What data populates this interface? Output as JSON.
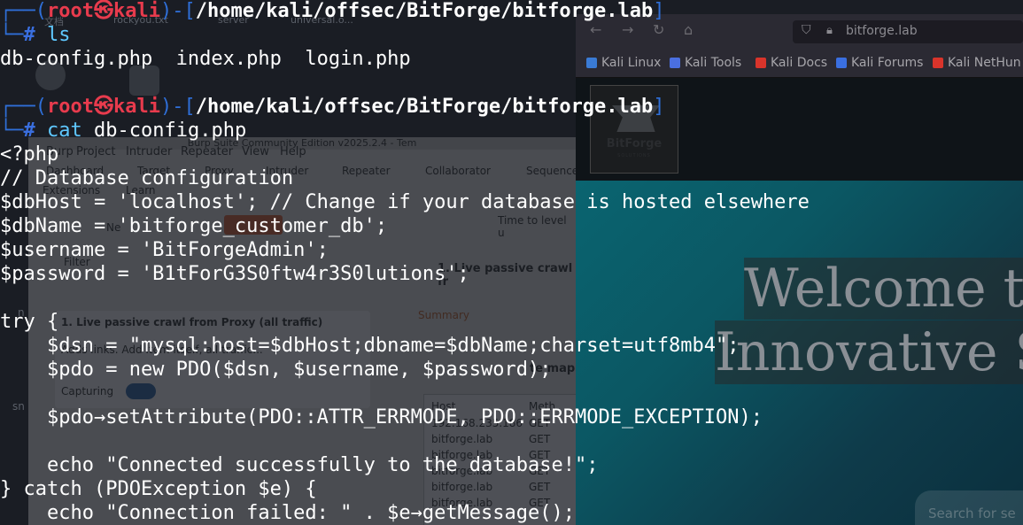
{
  "desktop": {
    "labels": [
      "文档",
      "rockyou.txt",
      "server",
      "universal.o..."
    ],
    "side_label_1": "sn",
    "side_label_2": "n"
  },
  "burp": {
    "window_title": "Burp Suite Community Edition v2025.2.4 - Tem",
    "menu": [
      "Burp",
      "Project",
      "Intruder",
      "Repeater",
      "View",
      "Help"
    ],
    "tabs": [
      "Dashboard",
      "Target",
      "Proxy",
      "Intruder",
      "Repeater",
      "Collaborator",
      "Sequence"
    ],
    "tabs2": [
      "Extensions",
      "Learn"
    ],
    "new_label": "Ne",
    "filter_label": "Filter",
    "time_label": "Time to level u",
    "task_title": "1. Live passive crawl from Proxy (all traffic)",
    "task_title_short": "1. Live passive crawl fr",
    "task_desc": "Adds links. Add item itself, all traffic...",
    "capturing_label": "Capturing",
    "summary_tab": "Summary",
    "site_map_label": "te map",
    "table_headers": [
      "Host",
      "Meth"
    ],
    "table_rows": [
      {
        "host": "192.168.235.186",
        "method": "GET"
      },
      {
        "host": "bitforge.lab",
        "method": "GET"
      },
      {
        "host": "bitforge.lab",
        "method": "GET"
      },
      {
        "host": "bitforge.lab",
        "method": "GET"
      },
      {
        "host": "bitforge.lab",
        "method": "GET"
      },
      {
        "host": "bitforge.lab",
        "method": "GET"
      }
    ]
  },
  "firefox": {
    "url": "bitforge.lab",
    "bookmarks": [
      {
        "label": "Kali Linux",
        "icon": "kali-dragon-icon",
        "color": "#3a7bd5"
      },
      {
        "label": "Kali Tools",
        "icon": "kali-tools-icon",
        "color": "#4a6fe0"
      },
      {
        "label": "Kali Docs",
        "icon": "kali-docs-icon",
        "color": "#d9342b"
      },
      {
        "label": "Kali Forums",
        "icon": "kali-forums-icon",
        "color": "#3a6fe0"
      },
      {
        "label": "Kali NetHun",
        "icon": "kali-nethunter-icon",
        "color": "#d9342b"
      }
    ],
    "site": {
      "logo_name": "BitForge",
      "logo_sub": "SOLUTIONS",
      "hero_line_1": "Welcome t",
      "hero_line_2": "Innovative S",
      "search_placeholder": "Search for se"
    }
  },
  "terminal": {
    "prompt": {
      "user": "root",
      "at": "㉿",
      "host": "kali",
      "cwd": "/home/kali/offsec/BitForge/bitforge.lab",
      "hash": "#"
    },
    "command_1": "ls",
    "ls_output": "db-config.php  index.php  login.php",
    "command_2_name": "cat",
    "command_2_arg": "db-config.php",
    "file_lines": [
      "<?php",
      "// Database configuration",
      "$dbHost = 'localhost'; // Change if your database is hosted elsewhere",
      "$dbName = 'bitforge_customer_db';",
      "$username = 'BitForgeAdmin';",
      "$password = 'B1tForG3S0ftw4r3S0lutions';",
      "",
      "try {",
      "    $dsn = \"mysql:host=$dbHost;dbname=$dbName;charset=utf8mb4\";",
      "    $pdo = new PDO($dsn, $username, $password);",
      "",
      "    $pdo→setAttribute(PDO::ATTR_ERRMODE, PDO::ERRMODE_EXCEPTION);",
      "",
      "    echo \"Connected successfully to the database!\";",
      "} catch (PDOException $e) {",
      "    echo \"Connection failed: \" . $e→getMessage();"
    ]
  }
}
